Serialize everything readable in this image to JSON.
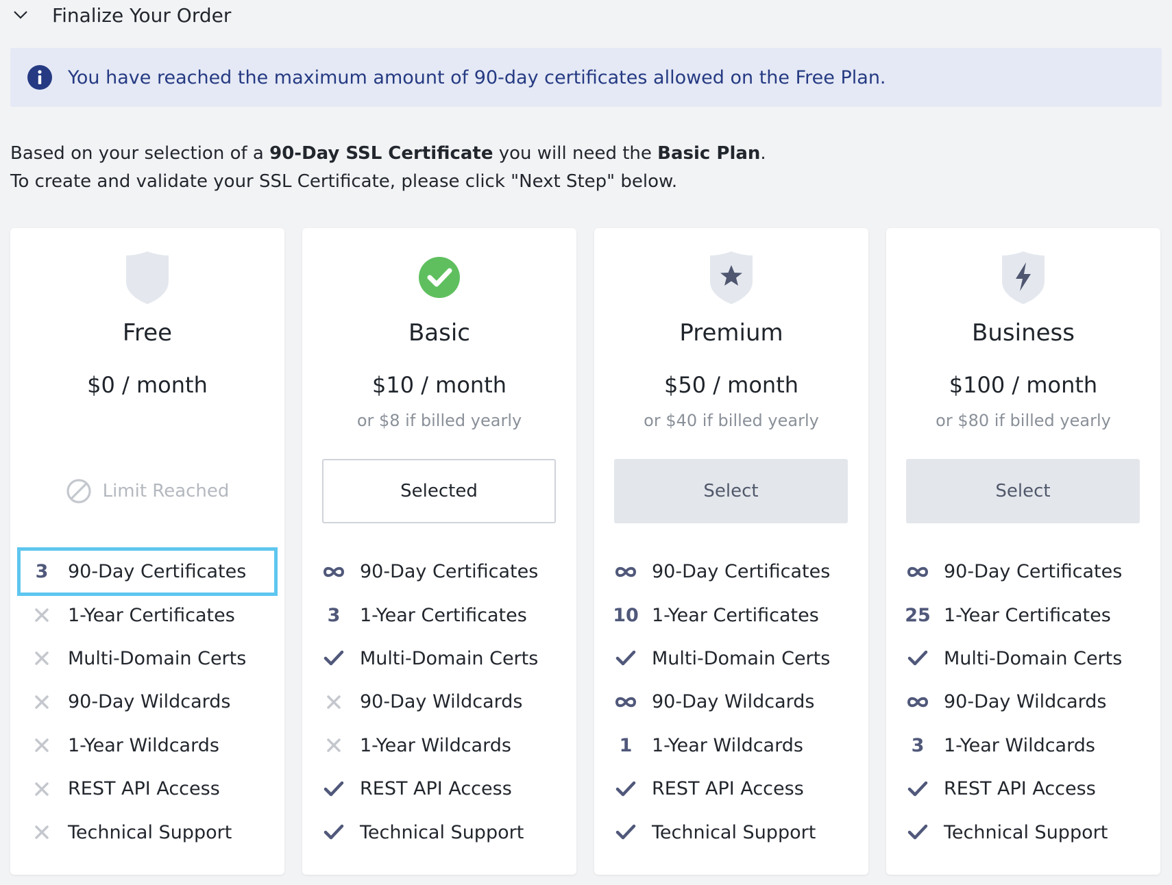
{
  "header": {
    "title": "Finalize Your Order"
  },
  "notice": {
    "text": "You have reached the maximum amount of 90-day certificates allowed on the Free Plan."
  },
  "intro": {
    "line1_pre": "Based on your selection of a ",
    "line1_bold1": "90-Day SSL Certificate",
    "line1_mid": " you will need the ",
    "line1_bold2": "Basic Plan",
    "line1_end": ".",
    "line2": "To create and validate your SSL Certificate, please click \"Next Step\" below."
  },
  "plans": [
    {
      "name": "Free",
      "price": "$0 / month",
      "yearly": "",
      "action": "Limit Reached",
      "features": [
        {
          "mark": "3",
          "label": "90-Day Certificates"
        },
        {
          "mark": "x",
          "label": "1-Year Certificates"
        },
        {
          "mark": "x",
          "label": "Multi-Domain Certs"
        },
        {
          "mark": "x",
          "label": "90-Day Wildcards"
        },
        {
          "mark": "x",
          "label": "1-Year Wildcards"
        },
        {
          "mark": "x",
          "label": "REST API Access"
        },
        {
          "mark": "x",
          "label": "Technical Support"
        }
      ]
    },
    {
      "name": "Basic",
      "price": "$10 / month",
      "yearly": "or $8 if billed yearly",
      "action": "Selected",
      "features": [
        {
          "mark": "inf",
          "label": "90-Day Certificates"
        },
        {
          "mark": "3",
          "label": "1-Year Certificates"
        },
        {
          "mark": "check",
          "label": "Multi-Domain Certs"
        },
        {
          "mark": "x",
          "label": "90-Day Wildcards"
        },
        {
          "mark": "x",
          "label": "1-Year Wildcards"
        },
        {
          "mark": "check",
          "label": "REST API Access"
        },
        {
          "mark": "check",
          "label": "Technical Support"
        }
      ]
    },
    {
      "name": "Premium",
      "price": "$50 / month",
      "yearly": "or $40 if billed yearly",
      "action": "Select",
      "features": [
        {
          "mark": "inf",
          "label": "90-Day Certificates"
        },
        {
          "mark": "10",
          "label": "1-Year Certificates"
        },
        {
          "mark": "check",
          "label": "Multi-Domain Certs"
        },
        {
          "mark": "inf",
          "label": "90-Day Wildcards"
        },
        {
          "mark": "1",
          "label": "1-Year Wildcards"
        },
        {
          "mark": "check",
          "label": "REST API Access"
        },
        {
          "mark": "check",
          "label": "Technical Support"
        }
      ]
    },
    {
      "name": "Business",
      "price": "$100 / month",
      "yearly": "or $80 if billed yearly",
      "action": "Select",
      "features": [
        {
          "mark": "inf",
          "label": "90-Day Certificates"
        },
        {
          "mark": "25",
          "label": "1-Year Certificates"
        },
        {
          "mark": "check",
          "label": "Multi-Domain Certs"
        },
        {
          "mark": "inf",
          "label": "90-Day Wildcards"
        },
        {
          "mark": "3",
          "label": "1-Year Wildcards"
        },
        {
          "mark": "check",
          "label": "REST API Access"
        },
        {
          "mark": "check",
          "label": "Technical Support"
        }
      ]
    }
  ],
  "colors": {
    "accent": "#253a82",
    "check_green": "#5fbf5f",
    "highlight": "#5ec6ef",
    "mark": "#50587a"
  }
}
